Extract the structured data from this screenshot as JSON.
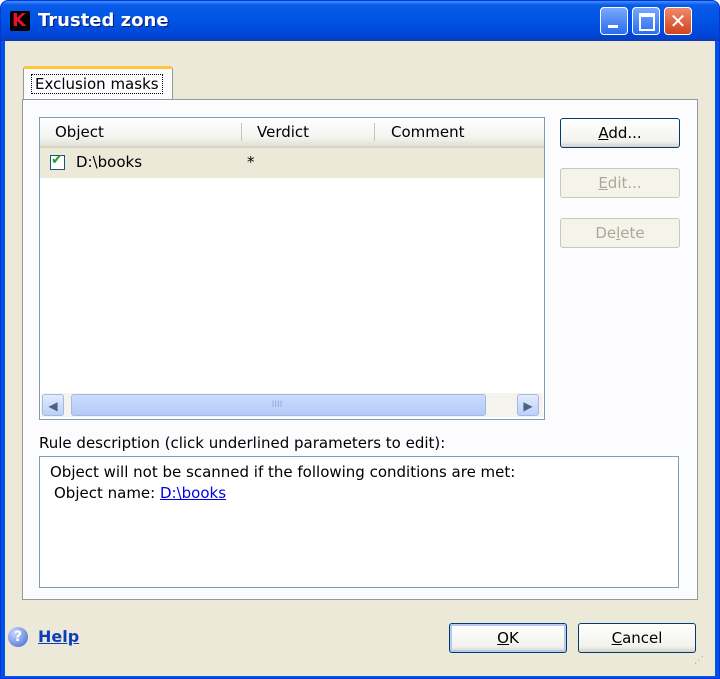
{
  "window": {
    "title": "Trusted zone"
  },
  "tabs": [
    {
      "label": "Exclusion masks",
      "selected": true
    }
  ],
  "list": {
    "columns": [
      "Object",
      "Verdict",
      "Comment"
    ],
    "rows": [
      {
        "checked": true,
        "object": "D:\\books",
        "verdict": "*",
        "comment": ""
      }
    ],
    "scroll_grip": "IIII"
  },
  "side_buttons": {
    "add": {
      "pre": "",
      "key": "A",
      "post": "dd..."
    },
    "edit": {
      "pre": "",
      "key": "E",
      "post": "dit..."
    },
    "delete": {
      "pre": "De",
      "key": "l",
      "post": "ete"
    }
  },
  "rule": {
    "label": "Rule description (click underlined parameters to edit):",
    "line1": "Object will not be scanned if the following conditions are met:",
    "line2_prefix": "Object name: ",
    "line2_value": "D:\\books"
  },
  "footer": {
    "help": "Help",
    "ok": {
      "key": "O",
      "post": "K"
    },
    "cancel": {
      "key": "C",
      "post": "ancel"
    }
  },
  "icons": {
    "app": "kaspersky-logo-icon",
    "help": "help-icon",
    "check": "checkmark-icon"
  },
  "colors": {
    "titlebar": "#0055e5",
    "client": "#ece9d8",
    "link": "#0000ee",
    "close": "#d2421c"
  }
}
